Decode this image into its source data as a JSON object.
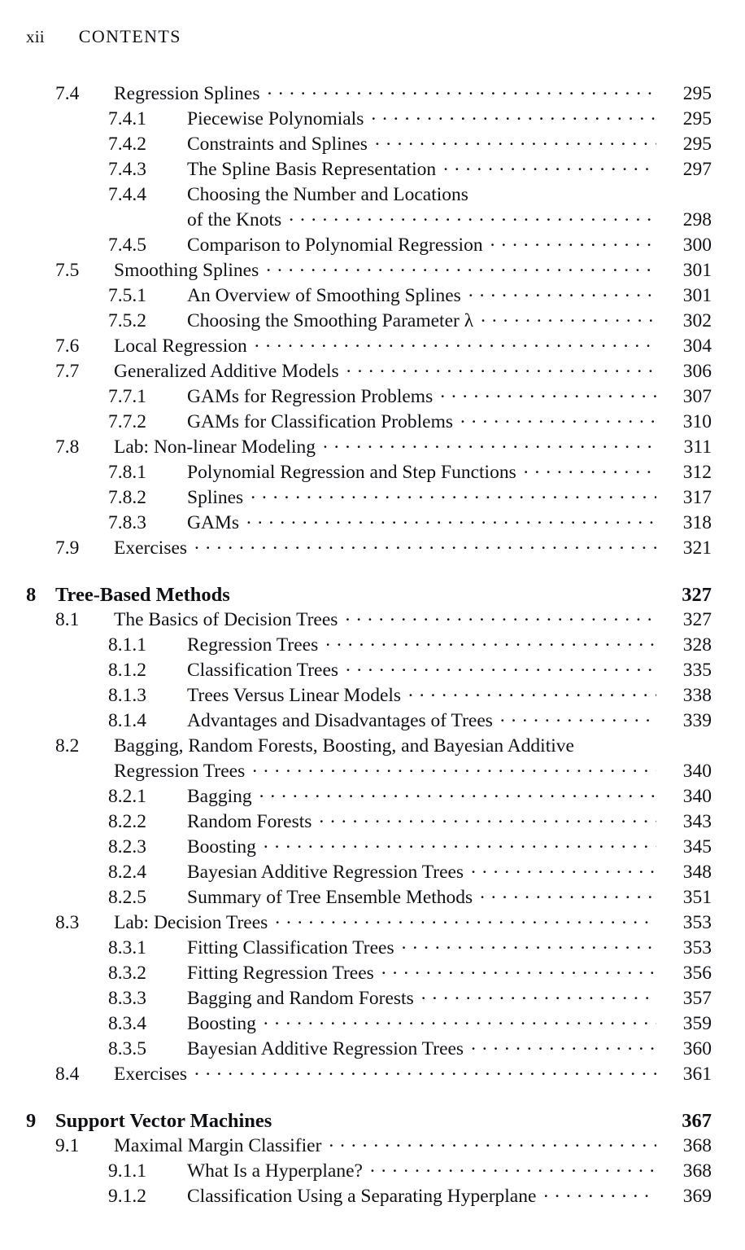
{
  "running_head": {
    "folio": "xii",
    "title": "CONTENTS"
  },
  "toc": {
    "entries": [
      {
        "kind": "section",
        "number": "7.4",
        "title": "Regression Splines",
        "page": "295"
      },
      {
        "kind": "subsection",
        "number": "7.4.1",
        "title": "Piecewise Polynomials",
        "page": "295"
      },
      {
        "kind": "subsection",
        "number": "7.4.2",
        "title": "Constraints and Splines",
        "page": "295"
      },
      {
        "kind": "subsection",
        "number": "7.4.3",
        "title": "The Spline Basis Representation",
        "page": "297"
      },
      {
        "kind": "subsection",
        "number": "7.4.4",
        "title": "Choosing the Number and Locations",
        "page": ""
      },
      {
        "kind": "continuation-sub",
        "number": "",
        "title": "of the Knots",
        "page": "298"
      },
      {
        "kind": "subsection",
        "number": "7.4.5",
        "title": "Comparison to Polynomial Regression",
        "page": "300"
      },
      {
        "kind": "section",
        "number": "7.5",
        "title": "Smoothing Splines",
        "page": "301"
      },
      {
        "kind": "subsection",
        "number": "7.5.1",
        "title": "An Overview of Smoothing Splines",
        "page": "301"
      },
      {
        "kind": "subsection",
        "number": "7.5.2",
        "title": "Choosing the Smoothing Parameter λ",
        "page": "302"
      },
      {
        "kind": "section",
        "number": "7.6",
        "title": "Local Regression",
        "page": "304"
      },
      {
        "kind": "section",
        "number": "7.7",
        "title": "Generalized Additive Models",
        "page": "306"
      },
      {
        "kind": "subsection",
        "number": "7.7.1",
        "title": "GAMs for Regression Problems",
        "page": "307"
      },
      {
        "kind": "subsection",
        "number": "7.7.2",
        "title": "GAMs for Classification Problems",
        "page": "310"
      },
      {
        "kind": "section",
        "number": "7.8",
        "title": "Lab: Non-linear Modeling",
        "page": "311"
      },
      {
        "kind": "subsection",
        "number": "7.8.1",
        "title": "Polynomial Regression and Step Functions",
        "page": "312"
      },
      {
        "kind": "subsection",
        "number": "7.8.2",
        "title": "Splines",
        "page": "317"
      },
      {
        "kind": "subsection",
        "number": "7.8.3",
        "title": "GAMs",
        "page": "318"
      },
      {
        "kind": "section",
        "number": "7.9",
        "title": "Exercises",
        "page": "321"
      },
      {
        "kind": "chapter",
        "number": "8",
        "title": "Tree-Based Methods",
        "page": "327"
      },
      {
        "kind": "section",
        "number": "8.1",
        "title": "The Basics of Decision Trees",
        "page": "327"
      },
      {
        "kind": "subsection",
        "number": "8.1.1",
        "title": "Regression Trees",
        "page": "328"
      },
      {
        "kind": "subsection",
        "number": "8.1.2",
        "title": "Classification Trees",
        "page": "335"
      },
      {
        "kind": "subsection",
        "number": "8.1.3",
        "title": "Trees Versus Linear Models",
        "page": "338"
      },
      {
        "kind": "subsection",
        "number": "8.1.4",
        "title": "Advantages and Disadvantages of Trees",
        "page": "339"
      },
      {
        "kind": "section",
        "number": "8.2",
        "title": "Bagging, Random Forests, Boosting, and Bayesian Additive",
        "page": ""
      },
      {
        "kind": "continuation-sec",
        "number": "",
        "title": "Regression Trees",
        "page": "340"
      },
      {
        "kind": "subsection",
        "number": "8.2.1",
        "title": "Bagging",
        "page": "340"
      },
      {
        "kind": "subsection",
        "number": "8.2.2",
        "title": "Random Forests",
        "page": "343"
      },
      {
        "kind": "subsection",
        "number": "8.2.3",
        "title": "Boosting",
        "page": "345"
      },
      {
        "kind": "subsection",
        "number": "8.2.4",
        "title": "Bayesian Additive Regression Trees",
        "page": "348"
      },
      {
        "kind": "subsection",
        "number": "8.2.5",
        "title": "Summary of Tree Ensemble Methods",
        "page": "351"
      },
      {
        "kind": "section",
        "number": "8.3",
        "title": "Lab: Decision Trees",
        "page": "353"
      },
      {
        "kind": "subsection",
        "number": "8.3.1",
        "title": "Fitting Classification Trees",
        "page": "353"
      },
      {
        "kind": "subsection",
        "number": "8.3.2",
        "title": "Fitting Regression Trees",
        "page": "356"
      },
      {
        "kind": "subsection",
        "number": "8.3.3",
        "title": "Bagging and Random Forests",
        "page": "357"
      },
      {
        "kind": "subsection",
        "number": "8.3.4",
        "title": "Boosting",
        "page": "359"
      },
      {
        "kind": "subsection",
        "number": "8.3.5",
        "title": "Bayesian Additive Regression Trees",
        "page": "360"
      },
      {
        "kind": "section",
        "number": "8.4",
        "title": "Exercises",
        "page": "361"
      },
      {
        "kind": "chapter",
        "number": "9",
        "title": "Support Vector Machines",
        "page": "367"
      },
      {
        "kind": "section",
        "number": "9.1",
        "title": "Maximal Margin Classifier",
        "page": "368"
      },
      {
        "kind": "subsection",
        "number": "9.1.1",
        "title": "What Is a Hyperplane?",
        "page": "368"
      },
      {
        "kind": "subsection",
        "number": "9.1.2",
        "title": "Classification Using a Separating Hyperplane",
        "page": "369"
      }
    ]
  }
}
